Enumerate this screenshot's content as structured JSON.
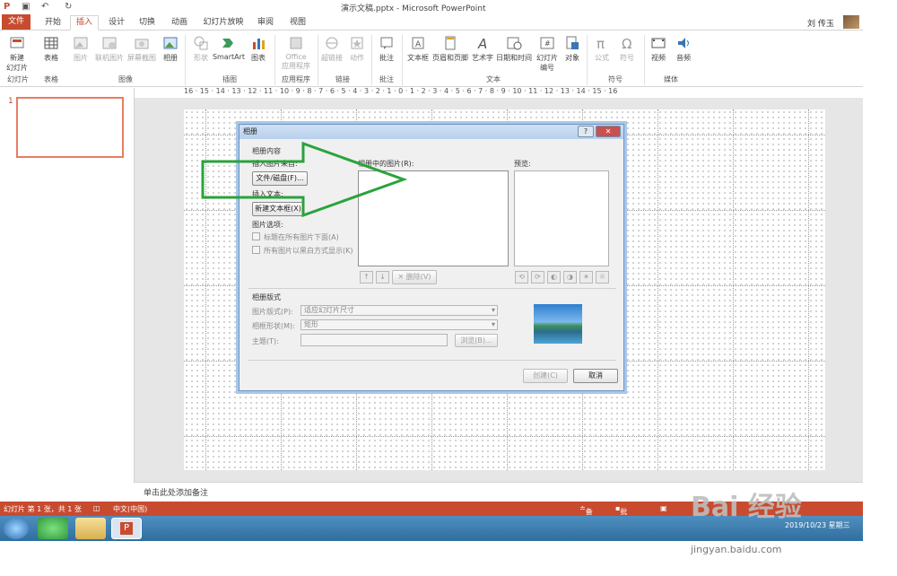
{
  "titlebar": {
    "title": "演示文稿.pptx - Microsoft PowerPoint",
    "user": "刘 传玉"
  },
  "tabs": [
    "文件",
    "开始",
    "插入",
    "设计",
    "切换",
    "动画",
    "幻灯片放映",
    "审阅",
    "视图"
  ],
  "active_tab": "插入",
  "ribbon": {
    "buttons": [
      {
        "label": "新建\n幻灯片",
        "icon": "new-slide-icon"
      },
      {
        "label": "表格",
        "icon": "table-icon"
      },
      {
        "label": "图片",
        "icon": "picture-icon"
      },
      {
        "label": "联机图片",
        "icon": "online-picture-icon"
      },
      {
        "label": "屏幕截图",
        "icon": "screenshot-icon"
      },
      {
        "label": "相册",
        "icon": "photo-album-icon"
      },
      {
        "label": "形状",
        "icon": "shapes-icon"
      },
      {
        "label": "SmartArt",
        "icon": "smartart-icon"
      },
      {
        "label": "图表",
        "icon": "chart-icon"
      },
      {
        "label": "Office\n应用程序",
        "icon": "office-apps-icon"
      },
      {
        "label": "超链接",
        "icon": "hyperlink-icon"
      },
      {
        "label": "动作",
        "icon": "action-icon"
      },
      {
        "label": "批注",
        "icon": "comment-icon"
      },
      {
        "label": "文本框",
        "icon": "textbox-icon"
      },
      {
        "label": "页眉和页脚",
        "icon": "header-footer-icon"
      },
      {
        "label": "艺术字",
        "icon": "wordart-icon"
      },
      {
        "label": "日期和时间",
        "icon": "datetime-icon"
      },
      {
        "label": "幻灯片\n编号",
        "icon": "slide-number-icon"
      },
      {
        "label": "对象",
        "icon": "object-icon"
      },
      {
        "label": "公式",
        "icon": "equation-icon"
      },
      {
        "label": "符号",
        "icon": "symbol-icon"
      },
      {
        "label": "视频",
        "icon": "video-icon"
      },
      {
        "label": "音频",
        "icon": "audio-icon"
      }
    ],
    "groups": [
      "幻灯片",
      "表格",
      "图像",
      "插图",
      "应用程序",
      "链接",
      "批注",
      "文本",
      "符号",
      "媒体"
    ]
  },
  "ruler": "16 · 15 · 14 · 13 · 12 · 11 · 10 · 9 · 8 · 7 · 6 · 5 · 4 · 3 · 2 · 1 · 0 · 1 · 2 · 3 · 4 · 5 · 6 · 7 · 8 · 9 · 10 · 11 · 12 · 13 · 14 · 15 · 16",
  "thumb_number": "1",
  "notes_placeholder": "单击此处添加备注",
  "dialog": {
    "title": "相册",
    "help": "?",
    "close": "✕",
    "album_content": "相册内容",
    "insert_from": "插入图片来自:",
    "file_disk_button": "文件/磁盘(F)...",
    "insert_text": "插入文本:",
    "new_textbox_button": "新建文本框(X)",
    "picture_options": "图片选项:",
    "caption_option": "标题在所有图片下面(A)",
    "bw_option": "所有图片以黑白方式显示(K)",
    "pictures_in_album": "相册中的图片(R):",
    "preview": "预览:",
    "remove_button": "删除(V)",
    "album_layout": "相册版式",
    "picture_layout_label": "图片版式(P):",
    "picture_layout_value": "适应幻灯片尺寸",
    "frame_shape_label": "相框形状(M):",
    "frame_shape_value": "矩形",
    "theme_label": "主题(T):",
    "browse_button": "浏览(B)...",
    "create_button": "创建(C)",
    "cancel_button": "取消"
  },
  "status": {
    "slide_info": "幻灯片 第 1 张，共 1 张",
    "language": "中文(中国)",
    "notes": "备注",
    "comments": "批注"
  },
  "taskbar": {
    "time": "16:??",
    "date": "2019/10/23 星期三"
  },
  "watermark": {
    "brand": "Bai 经验",
    "url": "jingyan.baidu.com"
  },
  "colors": {
    "accent": "#c84b2f",
    "arrow": "#2aa33c"
  }
}
